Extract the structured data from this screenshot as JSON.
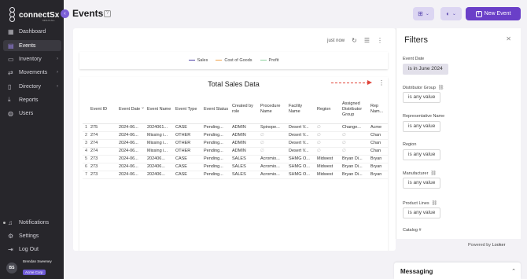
{
  "brand": {
    "name": "connectSx",
    "tagline": "MINUS ALL"
  },
  "sidebar": {
    "items": [
      {
        "label": "Dashboard",
        "icon": "grid-icon"
      },
      {
        "label": "Events",
        "icon": "calendar-icon",
        "active": true
      },
      {
        "label": "Inventory",
        "icon": "folder-icon",
        "has_arrow": true
      },
      {
        "label": "Movements",
        "icon": "shuffle-icon",
        "has_arrow": true
      },
      {
        "label": "Directory",
        "icon": "book-icon",
        "has_arrow": true
      },
      {
        "label": "Reports",
        "icon": "download-icon"
      },
      {
        "label": "Users",
        "icon": "users-icon"
      }
    ],
    "bottom_items": [
      {
        "label": "Notifications",
        "icon": "bell-icon"
      },
      {
        "label": "Settings",
        "icon": "gear-icon"
      },
      {
        "label": "Log Out",
        "icon": "logout-icon"
      }
    ],
    "user": {
      "initials": "BS",
      "name": "Brendan Sweeney",
      "org": "Acme Corp"
    }
  },
  "header": {
    "title": "Events",
    "new_event_label": "New Event"
  },
  "main": {
    "refresh_text": "just now",
    "legend": [
      {
        "label": "Sales",
        "color": "#4b3fa7"
      },
      {
        "label": "Cost of Goods",
        "color": "#f0a24a"
      },
      {
        "label": "Profit",
        "color": "#8fd3a0"
      }
    ],
    "table_title": "Total Sales Data",
    "columns": [
      "",
      "Event ID",
      "Event Date",
      "Event Name",
      "Event Type",
      "Event Status",
      "Created by role",
      "Procedure Name",
      "Facility Name",
      "Region",
      "Assigned Distributor Group",
      "Rep Nam..."
    ],
    "rows": [
      [
        "1",
        "275",
        "2024-06...",
        "2024061...",
        "CASE",
        "Pending...",
        "ADMIN",
        "Spinope...",
        "Desert V...",
        "∅",
        "Change...",
        "Acme"
      ],
      [
        "2",
        "274",
        "2024-06...",
        "Missing i...",
        "OTHER",
        "Pending...",
        "ADMIN",
        "∅",
        "Desert V...",
        "∅",
        "∅",
        "Chan"
      ],
      [
        "3",
        "274",
        "2024-06...",
        "Missing i...",
        "OTHER",
        "Pending...",
        "ADMIN",
        "∅",
        "Desert V...",
        "∅",
        "∅",
        "Chan"
      ],
      [
        "4",
        "274",
        "2024-06...",
        "Missing i...",
        "OTHER",
        "Pending...",
        "ADMIN",
        "∅",
        "Desert V...",
        "∅",
        "∅",
        "Chan"
      ],
      [
        "5",
        "273",
        "2024-06...",
        "202406...",
        "CASE",
        "Pending...",
        "SALES",
        "Acromio...",
        "SHMG O...",
        "Midwest",
        "Bryan Di...",
        "Bryan"
      ],
      [
        "6",
        "273",
        "2024-06...",
        "202406...",
        "CASE",
        "Pending...",
        "SALES",
        "Acromio...",
        "SHMG O...",
        "Midwest",
        "Bryan Di...",
        "Bryan"
      ],
      [
        "7",
        "273",
        "2024-06...",
        "202406...",
        "CASE",
        "Pending...",
        "SALES",
        "Acromio...",
        "SHMG O...",
        "Midwest",
        "Bryan Di...",
        "Bryan"
      ]
    ]
  },
  "filters": {
    "title": "Filters",
    "groups": [
      {
        "label": "Event Date",
        "value": "is in June 2024",
        "set": true,
        "link": false
      },
      {
        "label": "Distributor Group",
        "value": "is any value",
        "set": false,
        "link": true
      },
      {
        "label": "Representative Name",
        "value": "is any value",
        "set": false,
        "link": false
      },
      {
        "label": "Region",
        "value": "is any value",
        "set": false,
        "link": false
      },
      {
        "label": "Manufacturer",
        "value": "is any value",
        "set": false,
        "link": true
      },
      {
        "label": "Product Lines",
        "value": "is any value",
        "set": false,
        "link": true
      },
      {
        "label": "Catalog #",
        "value": "",
        "set": false,
        "link": false
      }
    ]
  },
  "footer": {
    "powered_by": "Powered by",
    "powered_brand": "Looker"
  },
  "messaging": {
    "label": "Messaging"
  }
}
